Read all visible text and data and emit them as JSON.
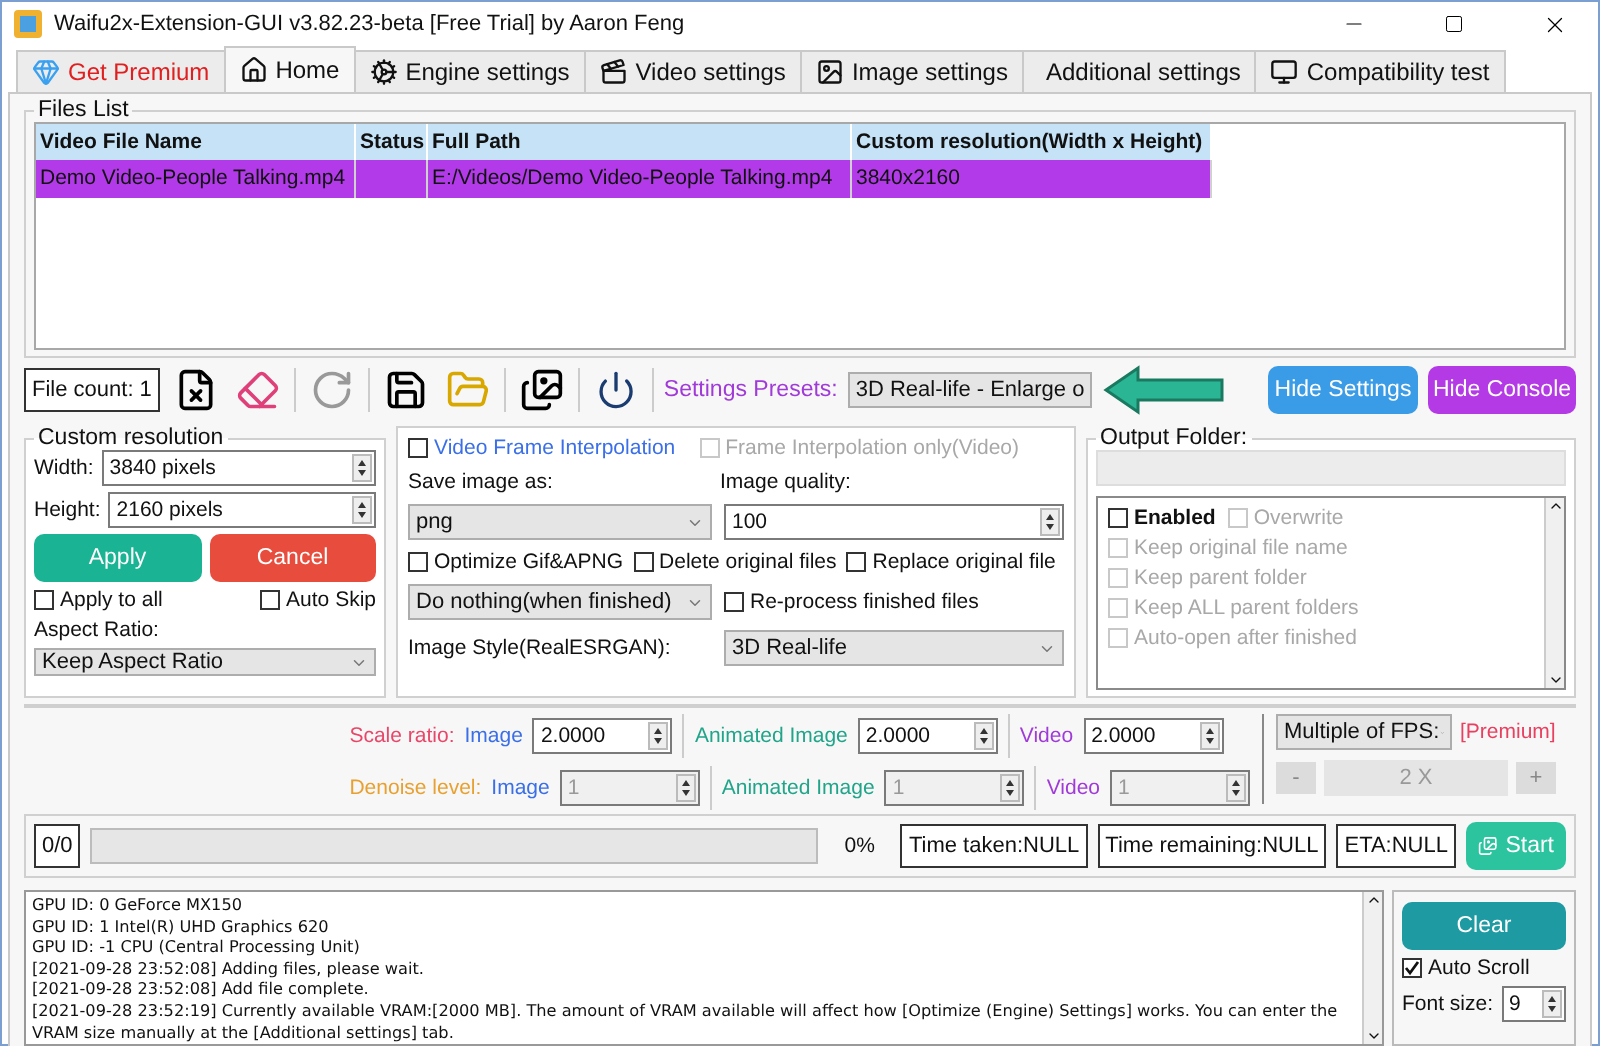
{
  "window": {
    "title": "Waifu2x-Extension-GUI v3.82.23-beta [Free Trial] by Aaron Feng"
  },
  "tabs": [
    {
      "kind": "premium",
      "label": "Get Premium",
      "selected": false
    },
    {
      "kind": "home",
      "label": "Home",
      "selected": true
    },
    {
      "kind": "engine",
      "label": "Engine settings",
      "selected": false
    },
    {
      "kind": "video",
      "label": "Video settings",
      "selected": false
    },
    {
      "kind": "image",
      "label": "Image settings",
      "selected": false
    },
    {
      "kind": "additional",
      "label": "Additional settings",
      "selected": false
    },
    {
      "kind": "compat",
      "label": "Compatibility test",
      "selected": false
    }
  ],
  "files_list": {
    "title": "Files List",
    "columns": [
      "Video File Name",
      "Status",
      "Full Path",
      "Custom resolution(Width x Height)"
    ],
    "rows": [
      {
        "cells": [
          "Demo Video-People Talking.mp4",
          "",
          "E:/Videos/Demo Video-People Talking.mp4",
          "3840x2160"
        ],
        "selected": true
      }
    ]
  },
  "toolbar": {
    "file_count": "File count: 1",
    "presets_label": "Settings Presets:",
    "presets_value": "3D Real-life - Enlarge o",
    "buttons": [
      "Hide Settings",
      "Hide Console"
    ]
  },
  "custom_resolution": {
    "title": "Custom resolution",
    "width_label": "Width:",
    "width_value": "3840 pixels",
    "height_label": "Height:",
    "height_value": "2160 pixels",
    "apply": "Apply",
    "cancel": "Cancel",
    "apply_to_all": {
      "label": "Apply to all",
      "checked": false
    },
    "auto_skip": {
      "label": "Auto Skip",
      "checked": false
    },
    "aspect_label": "Aspect Ratio:",
    "aspect_value": "Keep Aspect Ratio"
  },
  "image_options": {
    "frame_interpolation": {
      "label": "Video Frame Interpolation",
      "checked": false
    },
    "interpolation_only": {
      "label": "Frame Interpolation only(Video)",
      "checked": false,
      "disabled": true
    },
    "save_as_label": "Save image as:",
    "save_as_value": "png",
    "quality_label": "Image quality:",
    "quality_value": "100",
    "checks": [
      {
        "label": "Optimize Gif&APNG",
        "checked": false
      },
      {
        "label": "Delete original files",
        "checked": false
      },
      {
        "label": "Replace original file",
        "checked": false
      }
    ],
    "finish_action": "Do nothing(when finished)",
    "reprocess": {
      "label": "Re-process finished files",
      "checked": false
    },
    "style_label": "Image Style(RealESRGAN):",
    "style_value": "3D Real-life"
  },
  "output_folder": {
    "title": "Output Folder:",
    "options": [
      {
        "label": "Enabled",
        "checked": false,
        "disabled": false
      },
      {
        "label": "Overwrite",
        "checked": false,
        "disabled": true
      },
      {
        "label": "Keep original file name",
        "checked": false,
        "disabled": true
      },
      {
        "label": "Keep parent folder",
        "checked": false,
        "disabled": true
      },
      {
        "label": "Keep ALL parent folders",
        "checked": false,
        "disabled": true
      },
      {
        "label": "Auto-open after finished",
        "checked": false,
        "disabled": true
      }
    ]
  },
  "scale": {
    "label": "Scale ratio:",
    "fields": [
      {
        "kind": "image",
        "label": "Image",
        "value": "2.0000",
        "disabled": false
      },
      {
        "kind": "animated",
        "label": "Animated Image",
        "value": "2.0000",
        "disabled": false
      },
      {
        "kind": "video",
        "label": "Video",
        "value": "2.0000",
        "disabled": false
      }
    ]
  },
  "denoise": {
    "label": "Denoise level:",
    "fields": [
      {
        "kind": "image",
        "label": "Image",
        "value": "1",
        "disabled": true
      },
      {
        "kind": "animated",
        "label": "Animated Image",
        "value": "1",
        "disabled": true
      },
      {
        "kind": "video",
        "label": "Video",
        "value": "1",
        "disabled": true
      }
    ]
  },
  "fps": {
    "select": "Multiple of FPS:",
    "premium": "[Premium]",
    "minus": "-",
    "value": "2 X",
    "plus": "+"
  },
  "progress": {
    "count": "0/0",
    "level": 0,
    "percent": "0%",
    "time_taken": "Time taken:NULL",
    "time_remaining": "Time remaining:NULL",
    "eta": "ETA:NULL",
    "start": "Start"
  },
  "console": {
    "lines": [
      "GPU ID: 0 GeForce MX150",
      "GPU ID: 1 Intel(R) UHD Graphics 620",
      "GPU ID: -1 CPU (Central Processing Unit)",
      "[2021-09-28 23:52:08] Adding files, please wait.",
      "[2021-09-28 23:52:08] Add file complete.",
      "[2021-09-28 23:52:19] Currently available VRAM:[2000 MB]. The amount of VRAM available will affect how [Optimize (Engine) Settings] works. You can enter the VRAM size manually at the [Additional settings] tab."
    ],
    "clear": "Clear",
    "auto_scroll": {
      "label": "Auto Scroll",
      "checked": true
    },
    "font_size_label": "Font size:",
    "font_size": "9"
  }
}
